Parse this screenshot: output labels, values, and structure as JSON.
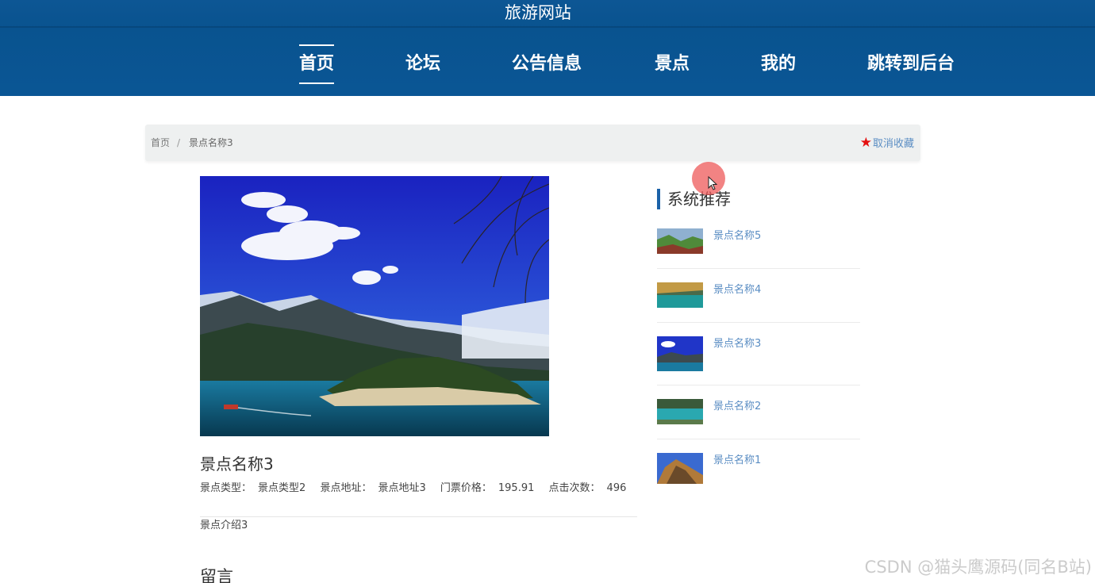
{
  "header": {
    "site_title": "旅游网站",
    "nav": [
      {
        "label": "首页",
        "active": true
      },
      {
        "label": "论坛",
        "active": false
      },
      {
        "label": "公告信息",
        "active": false
      },
      {
        "label": "景点",
        "active": false
      },
      {
        "label": "我的",
        "active": false
      },
      {
        "label": "跳转到后台",
        "active": false
      }
    ]
  },
  "breadcrumb": {
    "home": "首页",
    "separator": "/",
    "current": "景点名称3",
    "favorite": "取消收藏",
    "favorite_icon": "star-icon"
  },
  "detail": {
    "name": "景点名称3",
    "meta": [
      {
        "label": "景点类型：",
        "value": "景点类型2"
      },
      {
        "label": "景点地址：",
        "value": "景点地址3"
      },
      {
        "label": "门票价格：",
        "value": "195.91"
      },
      {
        "label": "点击次数：",
        "value": "496"
      }
    ],
    "intro": "景点介绍3",
    "comment_title": "留言"
  },
  "recommend": {
    "title": "系统推荐",
    "items": [
      {
        "name": "景点名称5"
      },
      {
        "name": "景点名称4"
      },
      {
        "name": "景点名称3"
      },
      {
        "name": "景点名称2"
      },
      {
        "name": "景点名称1"
      }
    ]
  },
  "watermark": "CSDN @猫头鹰源码(同名B站)",
  "colors": {
    "header_bg": "#0a5695",
    "link": "#5a8dc3",
    "accent": "#1b62a8",
    "star": "#e41010"
  }
}
